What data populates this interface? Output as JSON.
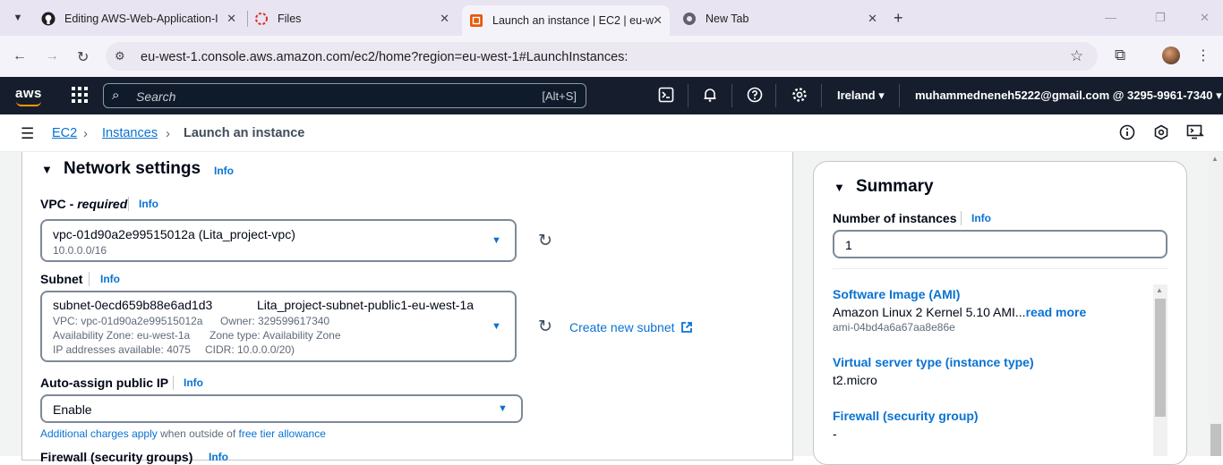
{
  "browser": {
    "tabs": [
      {
        "title": "Editing AWS-Web-Application-I",
        "icon": "github-icon"
      },
      {
        "title": "Files",
        "icon": "files-icon"
      },
      {
        "title": "Launch an instance | EC2 | eu-w",
        "icon": "aws-icon"
      },
      {
        "title": "New Tab",
        "icon": "chrome-icon"
      }
    ],
    "url": "eu-west-1.console.aws.amazon.com/ec2/home?region=eu-west-1#LaunchInstances:"
  },
  "aws": {
    "logo": "aws",
    "search_placeholder": "Search",
    "search_shortcut": "[Alt+S]",
    "region": "Ireland ▾",
    "account": "muhammedneneh5222@gmail.com @ 3295-9961-7340 ▾"
  },
  "breadcrumb": {
    "items": [
      "EC2",
      "Instances",
      "Launch an instance"
    ]
  },
  "network": {
    "title": "Network settings",
    "info": "Info",
    "vpc_label": "VPC - ",
    "vpc_required": "required",
    "vpc_value": "vpc-01d90a2e99515012a (Lita_project-vpc)",
    "vpc_cidr": "10.0.0.0/16",
    "subnet_label": "Subnet",
    "subnet_id": "subnet-0ecd659b88e6ad1d3",
    "subnet_name": "Lita_project-subnet-public1-eu-west-1a",
    "subnet_vpc": "VPC: vpc-01d90a2e99515012a",
    "subnet_owner": "Owner: 329599617340",
    "subnet_az": "Availability Zone: eu-west-1a",
    "subnet_zone_type": "Zone type: Availability Zone",
    "subnet_ips": "IP addresses available: 4075",
    "subnet_cidr": "CIDR: 10.0.0.0/20)",
    "create_subnet": "Create new subnet",
    "auto_ip_label": "Auto-assign public IP",
    "auto_ip_value": "Enable",
    "charges_link": "Additional charges apply",
    "charges_text": " when outside of ",
    "free_tier_link": "free tier allowance",
    "firewall_label": "Firewall (security groups)"
  },
  "summary": {
    "title": "Summary",
    "num_label": "Number of instances",
    "info": "Info",
    "num_value": "1",
    "ami_title": "Software Image (AMI)",
    "ami_value": "Amazon Linux 2 Kernel 5.10 AMI...",
    "ami_more": "read more",
    "ami_id": "ami-04bd4a6a67aa8e86e",
    "type_title": "Virtual server type (instance type)",
    "type_value": "t2.micro",
    "fw_title": "Firewall (security group)",
    "fw_value": "-"
  },
  "colors": {
    "aws_nav": "#161e2d",
    "link": "#0972d3",
    "aws_orange": "#ff9900"
  }
}
